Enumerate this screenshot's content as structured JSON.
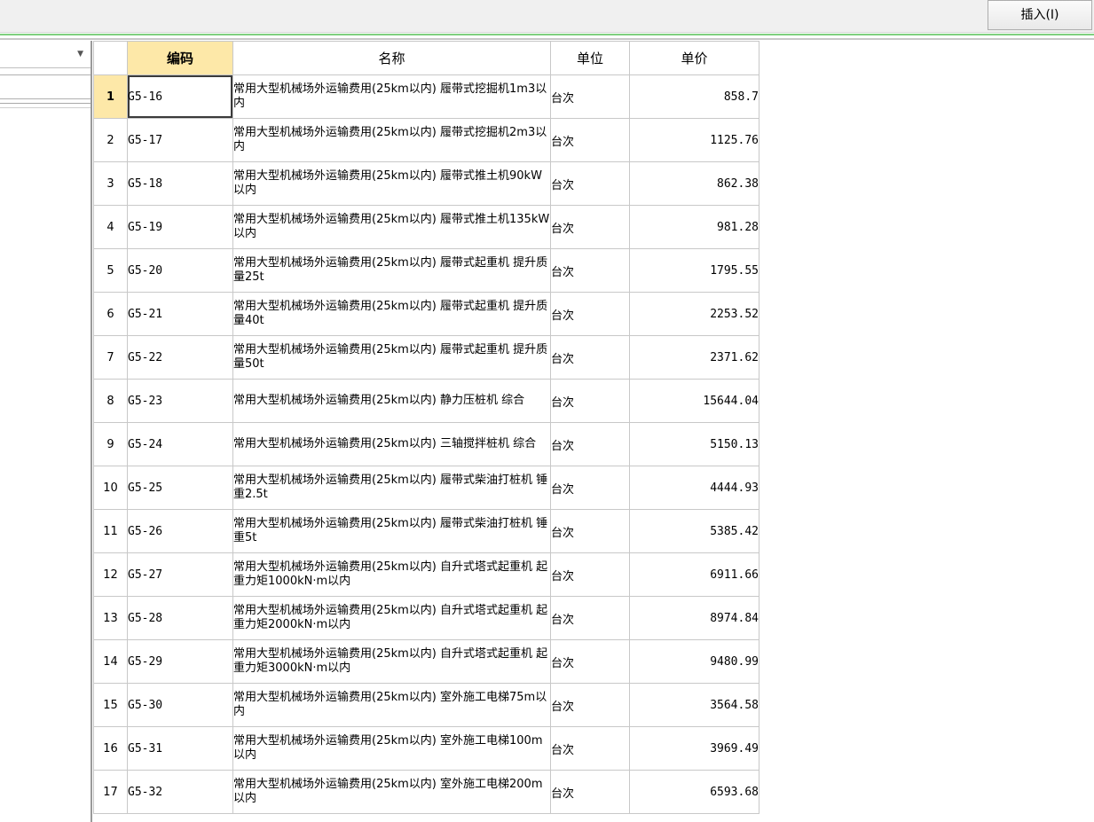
{
  "toolbar": {
    "insert_label": "插入(I)"
  },
  "table": {
    "headers": {
      "code": "编码",
      "name": "名称",
      "unit": "单位",
      "price": "单价"
    },
    "rows": [
      {
        "idx": "1",
        "code": "G5-16",
        "name": "常用大型机械场外运输费用(25km以内) 履带式挖掘机1m3以内",
        "unit": "台次",
        "price": "858.7"
      },
      {
        "idx": "2",
        "code": "G5-17",
        "name": "常用大型机械场外运输费用(25km以内) 履带式挖掘机2m3以内",
        "unit": "台次",
        "price": "1125.76"
      },
      {
        "idx": "3",
        "code": "G5-18",
        "name": "常用大型机械场外运输费用(25km以内) 履带式推土机90kW以内",
        "unit": "台次",
        "price": "862.38"
      },
      {
        "idx": "4",
        "code": "G5-19",
        "name": "常用大型机械场外运输费用(25km以内) 履带式推土机135kW以内",
        "unit": "台次",
        "price": "981.28"
      },
      {
        "idx": "5",
        "code": "G5-20",
        "name": "常用大型机械场外运输费用(25km以内) 履带式起重机 提升质量25t",
        "unit": "台次",
        "price": "1795.55"
      },
      {
        "idx": "6",
        "code": "G5-21",
        "name": "常用大型机械场外运输费用(25km以内) 履带式起重机 提升质量40t",
        "unit": "台次",
        "price": "2253.52"
      },
      {
        "idx": "7",
        "code": "G5-22",
        "name": "常用大型机械场外运输费用(25km以内) 履带式起重机 提升质量50t",
        "unit": "台次",
        "price": "2371.62"
      },
      {
        "idx": "8",
        "code": "G5-23",
        "name": "常用大型机械场外运输费用(25km以内) 静力压桩机 综合",
        "unit": "台次",
        "price": "15644.04"
      },
      {
        "idx": "9",
        "code": "G5-24",
        "name": "常用大型机械场外运输费用(25km以内) 三轴搅拌桩机 综合",
        "unit": "台次",
        "price": "5150.13"
      },
      {
        "idx": "10",
        "code": "G5-25",
        "name": "常用大型机械场外运输费用(25km以内) 履带式柴油打桩机 锤重2.5t",
        "unit": "台次",
        "price": "4444.93"
      },
      {
        "idx": "11",
        "code": "G5-26",
        "name": "常用大型机械场外运输费用(25km以内) 履带式柴油打桩机 锤重5t",
        "unit": "台次",
        "price": "5385.42"
      },
      {
        "idx": "12",
        "code": "G5-27",
        "name": "常用大型机械场外运输费用(25km以内) 自升式塔式起重机 起重力矩1000kN·m以内",
        "unit": "台次",
        "price": "6911.66"
      },
      {
        "idx": "13",
        "code": "G5-28",
        "name": "常用大型机械场外运输费用(25km以内) 自升式塔式起重机 起重力矩2000kN·m以内",
        "unit": "台次",
        "price": "8974.84"
      },
      {
        "idx": "14",
        "code": "G5-29",
        "name": "常用大型机械场外运输费用(25km以内) 自升式塔式起重机 起重力矩3000kN·m以内",
        "unit": "台次",
        "price": "9480.99"
      },
      {
        "idx": "15",
        "code": "G5-30",
        "name": "常用大型机械场外运输费用(25km以内) 室外施工电梯75m以内",
        "unit": "台次",
        "price": "3564.58"
      },
      {
        "idx": "16",
        "code": "G5-31",
        "name": "常用大型机械场外运输费用(25km以内) 室外施工电梯100m以内",
        "unit": "台次",
        "price": "3969.49"
      },
      {
        "idx": "17",
        "code": "G5-32",
        "name": "常用大型机械场外运输费用(25km以内) 室外施工电梯200m以内",
        "unit": "台次",
        "price": "6593.68"
      }
    ]
  }
}
